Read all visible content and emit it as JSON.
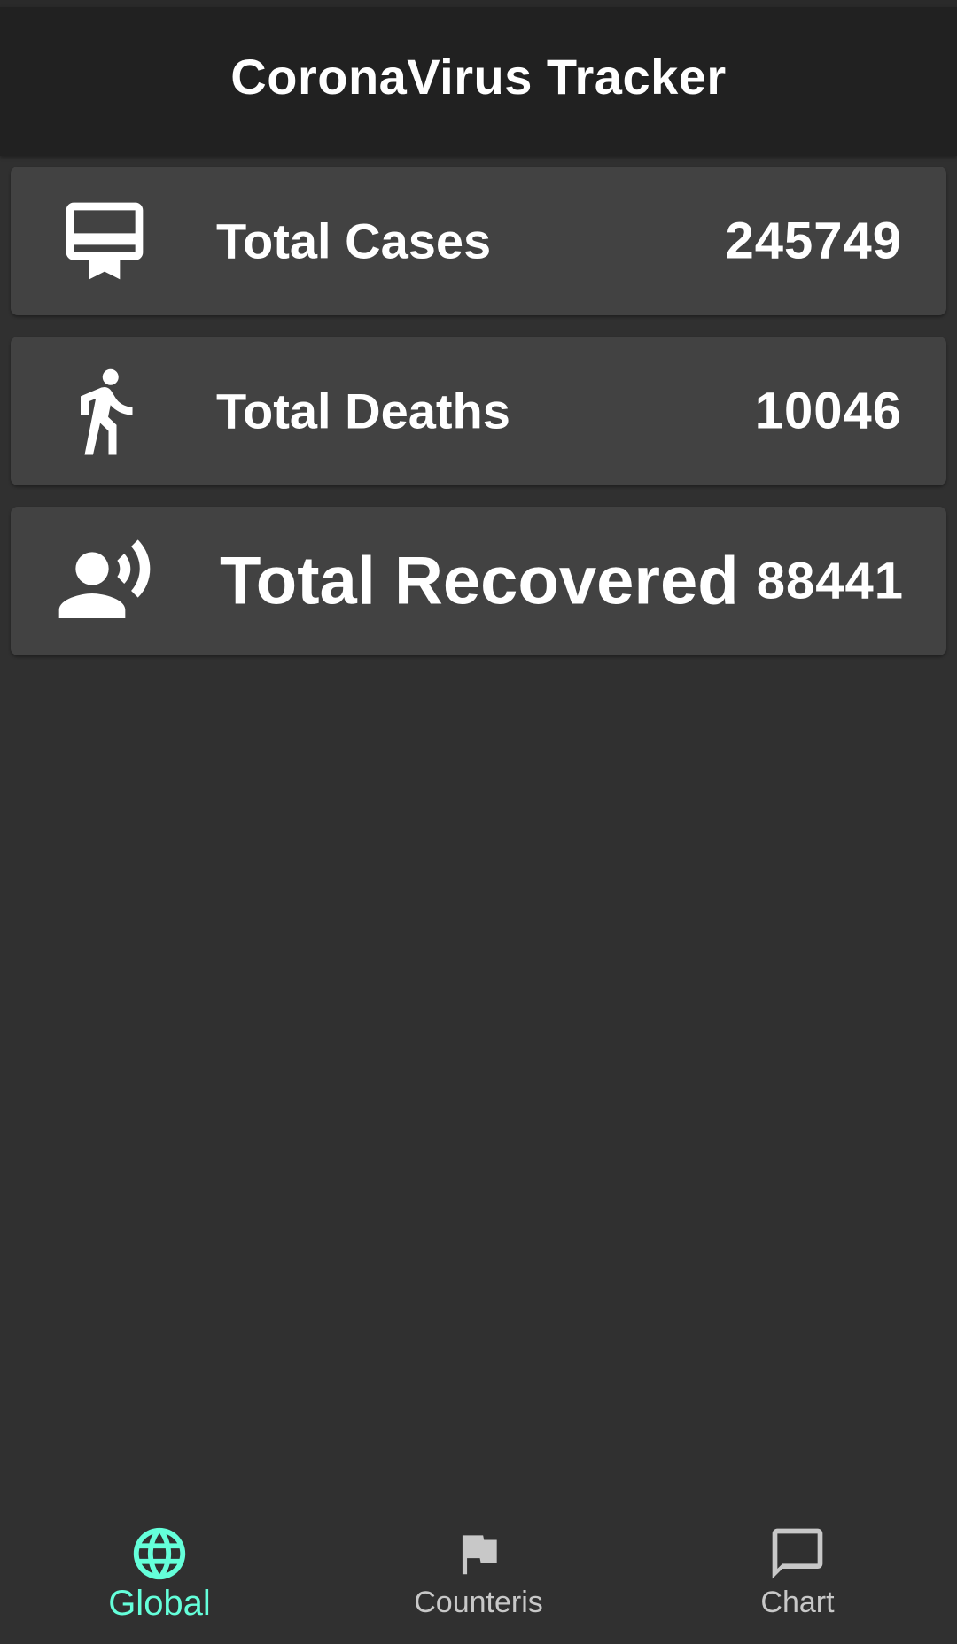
{
  "app": {
    "title": "CoronaVirus Tracker"
  },
  "cards": [
    {
      "icon": "card-membership-icon",
      "label": "Total Cases",
      "value": "245749"
    },
    {
      "icon": "directions-walk-icon",
      "label": "Total Deaths",
      "value": "10046"
    },
    {
      "icon": "record-voice-over-icon",
      "label": "Total Recovered",
      "value": "88441"
    }
  ],
  "bottom_nav": {
    "items": [
      {
        "icon": "globe-icon",
        "label": "Global",
        "active": true
      },
      {
        "icon": "flag-icon",
        "label": "Counteris",
        "active": false
      },
      {
        "icon": "chat-bubble-icon",
        "label": "Chart",
        "active": false
      }
    ]
  },
  "colors": {
    "background": "#303030",
    "app_bar": "#212121",
    "card": "#424242",
    "accent": "#64ffda",
    "inactive": "#c8c8c8"
  }
}
